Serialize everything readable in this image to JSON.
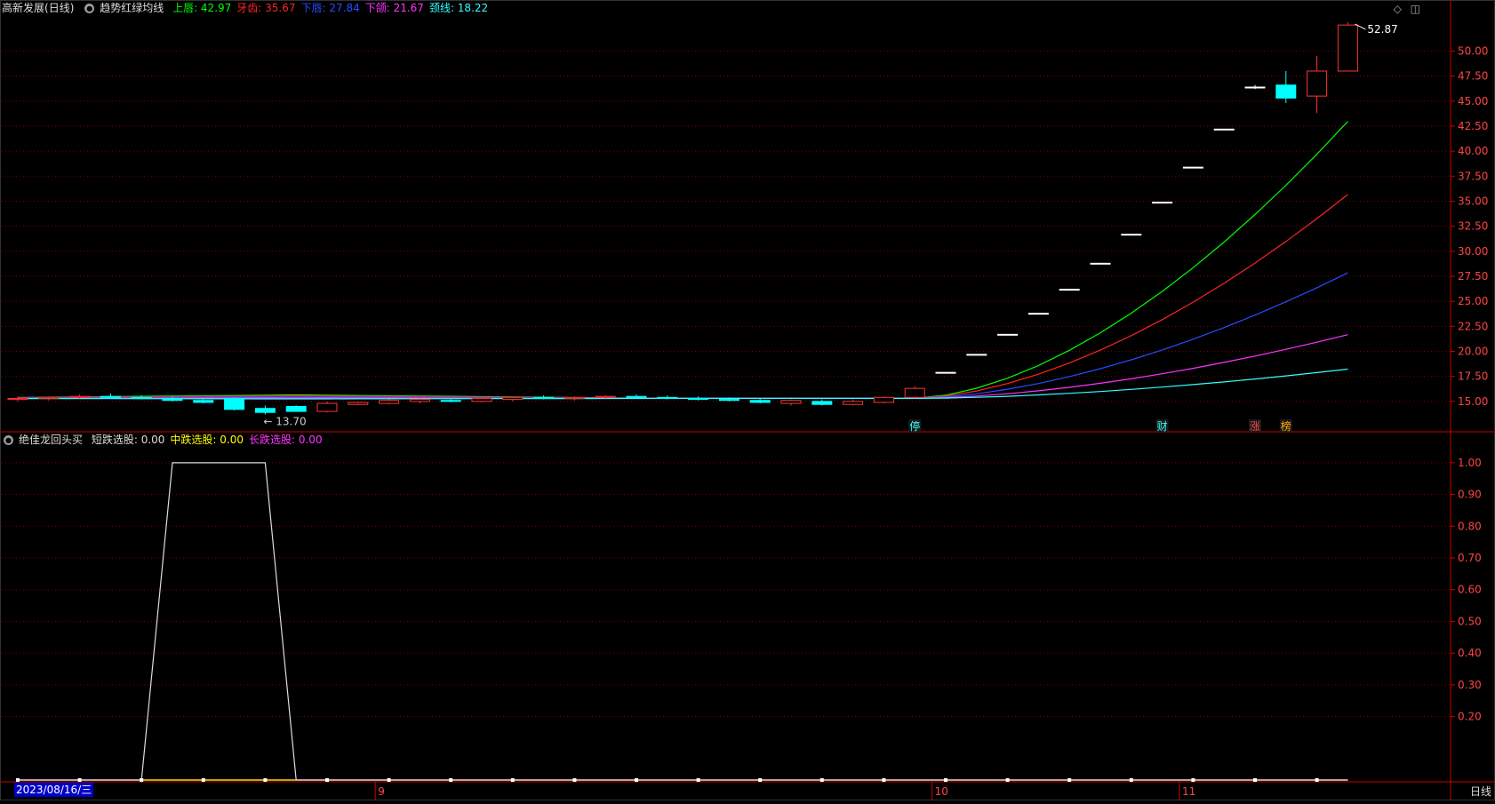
{
  "header": {
    "stock_name": "高新发展",
    "period": "(日线)",
    "indicator_name": "趋势红绿均线",
    "lines": [
      {
        "label": "上唇: 42.97",
        "color": "#00ff00"
      },
      {
        "label": "牙齿: 35.67",
        "color": "#ff2222"
      },
      {
        "label": "下唇: 27.84",
        "color": "#2a4bff"
      },
      {
        "label": "下颌: 21.67",
        "color": "#ff33ff"
      },
      {
        "label": "颈线: 18.22",
        "color": "#33ffff"
      }
    ]
  },
  "lower_header": {
    "indicator_name": "绝佳龙回头买",
    "lines": [
      {
        "label": "短跌选股: 0.00",
        "color": "#dddddd"
      },
      {
        "label": "中跌选股: 0.00",
        "color": "#ffff00"
      },
      {
        "label": "长跌选股: 0.00",
        "color": "#ff33ff"
      }
    ]
  },
  "top_icons": {
    "diamond": "◇",
    "window": "◫"
  },
  "annotations": {
    "high_label": "52.87",
    "low_label": "13.70"
  },
  "event_markers": [
    {
      "label": "停",
      "color": "#33ffff"
    },
    {
      "label": "财",
      "color": "#33ffff"
    },
    {
      "label": "涨",
      "color": "#ff4444"
    },
    {
      "label": "榜",
      "color": "#ffaa00"
    }
  ],
  "footer": {
    "date": "2023/08/16/三",
    "period_label": "日线",
    "months": [
      "9",
      "10",
      "11"
    ]
  },
  "colors": {
    "grid": "#7a0000",
    "axis": "#cc0000",
    "up": "#ff3333",
    "down": "#00ffff",
    "flat": "#ffffff",
    "bg": "#000000"
  },
  "chart_data": [
    {
      "type": "candlestick",
      "title": "高新发展 (日线) 趋势红绿均线",
      "y_ticks": [
        15.0,
        17.5,
        20.0,
        22.5,
        25.0,
        27.5,
        30.0,
        32.5,
        35.0,
        37.5,
        40.0,
        42.5,
        45.0,
        47.5,
        50.0
      ],
      "ylim": [
        12.5,
        53.5
      ],
      "highest": 52.87,
      "lowest": 13.7,
      "candles": [
        {
          "o": 15.2,
          "h": 15.5,
          "l": 15.0,
          "c": 15.3
        },
        {
          "o": 15.3,
          "h": 15.5,
          "l": 15.1,
          "c": 15.4
        },
        {
          "o": 15.4,
          "h": 15.7,
          "l": 15.2,
          "c": 15.5
        },
        {
          "o": 15.5,
          "h": 15.8,
          "l": 15.3,
          "c": 15.4
        },
        {
          "o": 15.4,
          "h": 15.6,
          "l": 15.2,
          "c": 15.3
        },
        {
          "o": 15.3,
          "h": 15.5,
          "l": 15.0,
          "c": 15.1
        },
        {
          "o": 15.1,
          "h": 15.3,
          "l": 14.8,
          "c": 14.9
        },
        {
          "o": 15.3,
          "h": 15.4,
          "l": 14.1,
          "c": 14.2
        },
        {
          "o": 14.3,
          "h": 14.6,
          "l": 13.7,
          "c": 13.9
        },
        {
          "o": 14.5,
          "h": 14.6,
          "l": 14.0,
          "c": 14.0
        },
        {
          "o": 14.0,
          "h": 15.0,
          "l": 13.9,
          "c": 14.8
        },
        {
          "o": 14.7,
          "h": 15.0,
          "l": 14.6,
          "c": 14.9
        },
        {
          "o": 14.8,
          "h": 15.2,
          "l": 14.7,
          "c": 15.1
        },
        {
          "o": 15.0,
          "h": 15.3,
          "l": 14.8,
          "c": 15.2
        },
        {
          "o": 15.1,
          "h": 15.3,
          "l": 14.9,
          "c": 15.0
        },
        {
          "o": 15.0,
          "h": 15.4,
          "l": 14.9,
          "c": 15.3
        },
        {
          "o": 15.2,
          "h": 15.5,
          "l": 15.0,
          "c": 15.4
        },
        {
          "o": 15.4,
          "h": 15.6,
          "l": 15.2,
          "c": 15.3
        },
        {
          "o": 15.3,
          "h": 15.5,
          "l": 15.1,
          "c": 15.4
        },
        {
          "o": 15.4,
          "h": 15.6,
          "l": 15.2,
          "c": 15.5
        },
        {
          "o": 15.5,
          "h": 15.7,
          "l": 15.3,
          "c": 15.4
        },
        {
          "o": 15.4,
          "h": 15.6,
          "l": 15.2,
          "c": 15.3
        },
        {
          "o": 15.3,
          "h": 15.5,
          "l": 15.1,
          "c": 15.2
        },
        {
          "o": 15.2,
          "h": 15.4,
          "l": 15.0,
          "c": 15.1
        },
        {
          "o": 15.1,
          "h": 15.3,
          "l": 14.8,
          "c": 14.9
        },
        {
          "o": 14.8,
          "h": 15.2,
          "l": 14.6,
          "c": 15.1
        },
        {
          "o": 15.0,
          "h": 15.2,
          "l": 14.6,
          "c": 14.7
        },
        {
          "o": 14.7,
          "h": 15.2,
          "l": 14.6,
          "c": 15.0
        },
        {
          "o": 14.9,
          "h": 15.5,
          "l": 14.8,
          "c": 15.4
        },
        {
          "o": 15.4,
          "h": 16.5,
          "l": 15.3,
          "c": 16.3
        },
        {
          "o": 17.9,
          "h": 17.9,
          "l": 17.9,
          "c": 17.9
        },
        {
          "o": 19.7,
          "h": 19.7,
          "l": 19.7,
          "c": 19.7
        },
        {
          "o": 21.7,
          "h": 21.7,
          "l": 21.7,
          "c": 21.7
        },
        {
          "o": 23.8,
          "h": 23.8,
          "l": 23.8,
          "c": 23.8
        },
        {
          "o": 26.2,
          "h": 26.2,
          "l": 26.2,
          "c": 26.2
        },
        {
          "o": 28.8,
          "h": 28.8,
          "l": 28.8,
          "c": 28.8
        },
        {
          "o": 31.7,
          "h": 31.7,
          "l": 31.7,
          "c": 31.7
        },
        {
          "o": 34.9,
          "h": 34.9,
          "l": 34.9,
          "c": 34.9
        },
        {
          "o": 38.4,
          "h": 38.4,
          "l": 38.4,
          "c": 38.4
        },
        {
          "o": 42.2,
          "h": 42.2,
          "l": 42.2,
          "c": 42.2
        },
        {
          "o": 46.4,
          "h": 46.6,
          "l": 46.2,
          "c": 46.4
        },
        {
          "o": 46.6,
          "h": 48.0,
          "l": 44.8,
          "c": 45.3
        },
        {
          "o": 45.5,
          "h": 49.5,
          "l": 43.8,
          "c": 48.0
        },
        {
          "o": 48.0,
          "h": 52.87,
          "l": 48.0,
          "c": 52.6
        }
      ],
      "series": [
        {
          "name": "上唇",
          "start": 15.3,
          "end": 42.97
        },
        {
          "name": "牙齿",
          "start": 15.3,
          "end": 35.67
        },
        {
          "name": "下唇",
          "start": 15.3,
          "end": 27.84
        },
        {
          "name": "下颌",
          "start": 15.3,
          "end": 21.67
        },
        {
          "name": "颈线",
          "start": 15.3,
          "end": 18.22
        }
      ]
    },
    {
      "type": "line",
      "title": "绝佳龙回头买",
      "y_ticks": [
        0.2,
        0.3,
        0.4,
        0.5,
        0.6,
        0.7,
        0.8,
        0.9,
        1.0
      ],
      "ylim": [
        0,
        1.05
      ],
      "series": [
        {
          "name": "短跌选股",
          "values": [
            0,
            0,
            0,
            0,
            0,
            1,
            1,
            1,
            1,
            0,
            0,
            0,
            0,
            0,
            0,
            0,
            0,
            0,
            0,
            0,
            0,
            0,
            0,
            0,
            0,
            0,
            0,
            0,
            0,
            0,
            0,
            0,
            0,
            0,
            0,
            0,
            0,
            0,
            0,
            0,
            0,
            0,
            0,
            0
          ]
        },
        {
          "name": "中跌选股",
          "values": [
            0,
            0,
            0,
            0,
            0,
            0,
            0,
            0,
            0,
            0,
            0,
            0,
            0,
            0,
            0,
            0,
            0,
            0,
            0,
            0,
            0,
            0,
            0,
            0,
            0,
            0,
            0,
            0,
            0,
            0,
            0,
            0,
            0,
            0,
            0,
            0,
            0,
            0,
            0,
            0,
            0,
            0,
            0,
            0
          ]
        },
        {
          "name": "长跌选股",
          "values": [
            0,
            0,
            0,
            0,
            0,
            0,
            0,
            0,
            0,
            0,
            0,
            0,
            0,
            0,
            0,
            0,
            0,
            0,
            0,
            0,
            0,
            0,
            0,
            0,
            0,
            0,
            0,
            0,
            0,
            0,
            0,
            0,
            0,
            0,
            0,
            0,
            0,
            0,
            0,
            0,
            0,
            0,
            0,
            0
          ]
        }
      ]
    }
  ]
}
